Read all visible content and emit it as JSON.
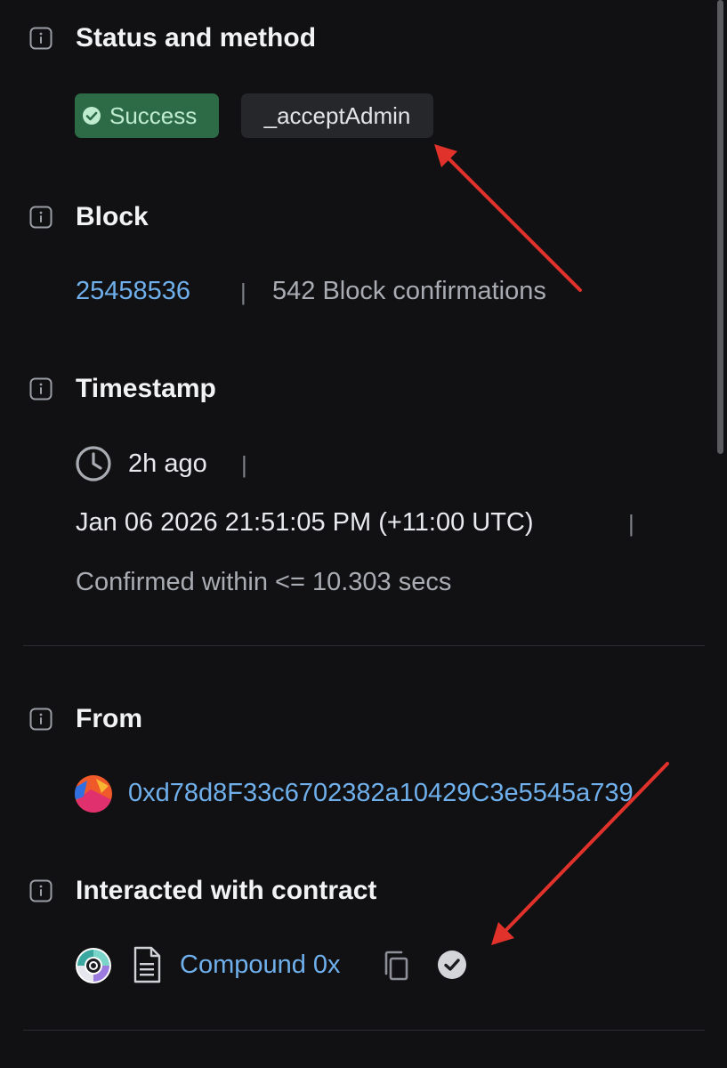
{
  "status_section": {
    "title": "Status and method",
    "status_label": "Success",
    "method_label": "_acceptAdmin",
    "success_color": "#2d6b47"
  },
  "block_section": {
    "title": "Block",
    "block_number": "25458536",
    "separator": "|",
    "confirmations": "542 Block confirmations"
  },
  "timestamp_section": {
    "title": "Timestamp",
    "relative": "2h ago",
    "separator": "|",
    "datetime": "Jan 06 2026 21:51:05 PM (+11:00 UTC)",
    "confirmed": "Confirmed within <= 10.303 secs"
  },
  "from_section": {
    "title": "From",
    "address": "0xd78d8F33c6702382a10429C3e5545a739"
  },
  "contract_section": {
    "title": "Interacted with contract",
    "contract_name": "Compound 0x"
  },
  "icons": {
    "info": "info-icon",
    "success": "check-circle-icon",
    "clock": "clock-icon",
    "document": "document-icon",
    "copy": "copy-icon",
    "verified": "verified-check-icon"
  },
  "colors": {
    "background": "#111113",
    "link": "#6fb0ec",
    "annotation_arrow": "#e0322b"
  }
}
